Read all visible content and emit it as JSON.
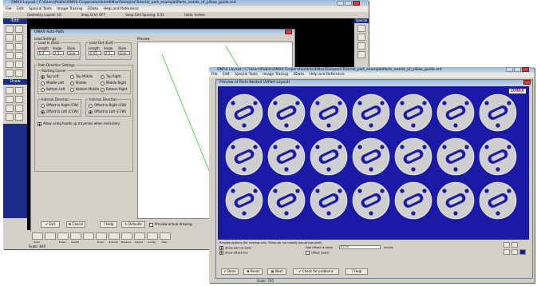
{
  "back_window": {
    "title": "OMAX Layout | C:\\Users\\Public\\OMAX Corporation\\IntelliMax\\Samples\\Tutorial_part_example\\Parts_nozzle_of_pillow_guide.ord",
    "menu": [
      "File",
      "Edit",
      "Special Tools",
      "Image Tracing",
      "2Data",
      "Help and Reference"
    ],
    "status": {
      "geometry_layout": "Geometry Layout: 10",
      "snap_grid": "Snap Grid: OFF",
      "snap_grid_spacing": "Snap Grid Spacing: 0.01",
      "units": "Units: Inches"
    },
    "left_edit_header": "Edit",
    "left_draw_header": "Draw",
    "right_special_header": "Special",
    "dialog": {
      "title": "OMAX Auto-Path",
      "lead_settings_label": "Lead Settings",
      "lead_in_label": "Lead In (Exit)",
      "lead_out_label": "Lead Out (Exit)",
      "length_label": "Length",
      "angle_label": "Angle",
      "style_label": "Style",
      "lead_in_length": "0.2",
      "lead_in_angle": "2.5",
      "lead_in_style": "Line",
      "lead_out_length": "0.05",
      "lead_out_angle": "2.5",
      "lead_out_style": "Line",
      "path_direction_label": "Path Direction Settings",
      "starting_corner_label": "Starting Corner",
      "corners": [
        "Top Left",
        "Top Middle",
        "Top Right",
        "Middle Left",
        "Middle",
        "Middle Right",
        "Bottom Left",
        "Bottom Middle",
        "Bottom Right"
      ],
      "internal_direction_label": "Internal Direction",
      "external_direction_label": "Internal Direction",
      "offset_right": "Offset to Right (CW)",
      "offset_left": "Offset to Left (CCW)",
      "allow_heads_label": "Allow using heads up traverses  when necessary",
      "preview_label": "Preview",
      "buttons": {
        "ok": "Exit",
        "cancel": "Cancel",
        "help": "Help",
        "defaults": "Defaults",
        "preview_drawing": "Preview actual drawing"
      }
    },
    "bottom_toolbar": [
      "Undo",
      "",
      "Erase",
      "Qualify",
      "",
      "Zoom",
      "Extents",
      "Measure",
      "Inquire",
      "Config",
      "Help"
    ],
    "scale_text": "Scale: 640"
  },
  "front_window": {
    "title": "OMAX Layout | C:\\Users\\Public\\OMAX Corporation\\IntelliMax\\Samples\\Tutorial_part_example\\Parts_nozzle_of_pillow_guide.ord",
    "menu": [
      "File",
      "Edit",
      "Special Tools",
      "Image Tracing",
      "2Data",
      "Help and Reference"
    ],
    "dialog_title": "Preview of Parts Nested (A/Part Layout)",
    "logo": "OMAX",
    "grid": {
      "rows": 3,
      "cols": 7
    },
    "bottom_panel": {
      "note": "Preview options (for nesting only. These do not modify actual tool path)",
      "show_part_as_solid": "Show part as solid",
      "show_offset_line": "Show offset line",
      "tool_offset_label": "Tool Offset to show",
      "tool_offset_value": "0.070",
      "units": "inches",
      "offset_leads": "Offset Leads"
    },
    "buttons": {
      "done": "Done",
      "reset": "Reset",
      "next": "Next",
      "check": "Check for problems",
      "help": "Help"
    },
    "scale_text": "Scale: 765"
  },
  "colors": {
    "nest_background": "#1a1aa6",
    "part_fill": "#cfcfcf",
    "dark_canvas": "#000000",
    "preview_outline": "#6a2aa0",
    "lead_green": "#2ecc40"
  }
}
